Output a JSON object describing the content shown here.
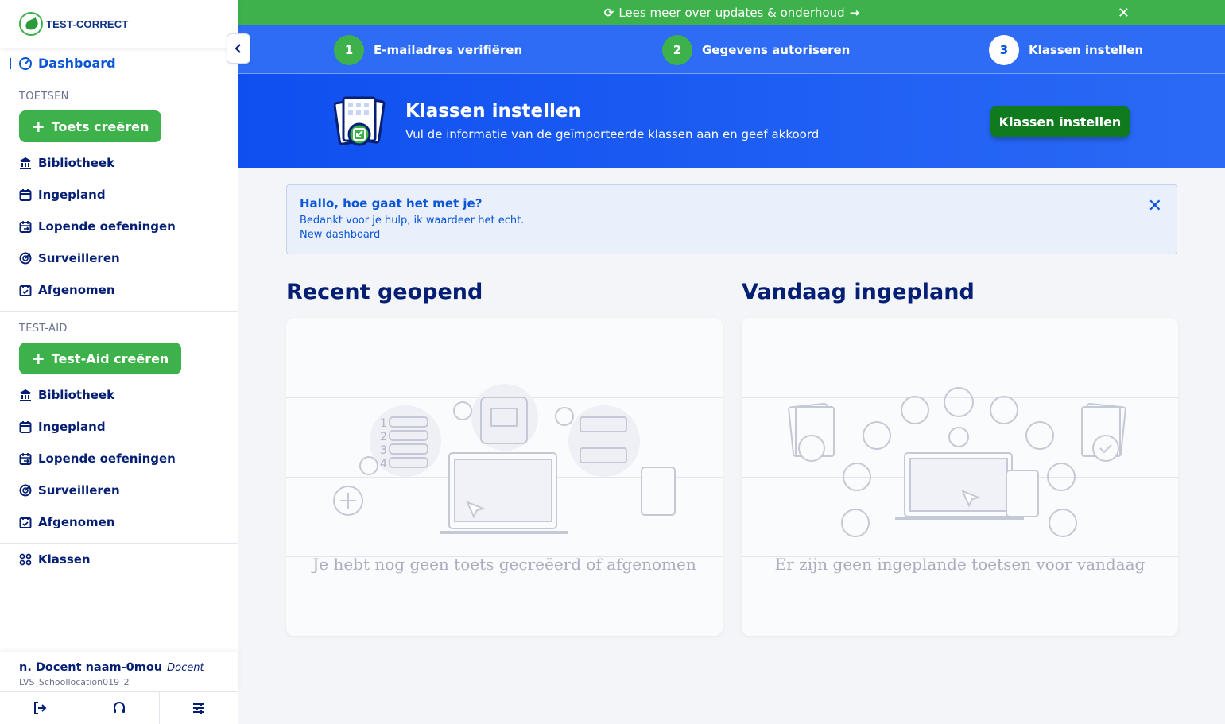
{
  "sidebar": {
    "logo_text": "TEST-CORRECT",
    "dashboard": "Dashboard",
    "toetsen": {
      "title": "TOETSEN",
      "create": "Toets creëren",
      "items": [
        "Bibliotheek",
        "Ingepland",
        "Lopende oefeningen",
        "Surveilleren",
        "Afgenomen"
      ]
    },
    "testaid": {
      "title": "TEST-AID",
      "create": "Test-Aid creëren",
      "items": [
        "Bibliotheek",
        "Ingepland",
        "Lopende oefeningen",
        "Surveilleren",
        "Afgenomen"
      ]
    },
    "klassen": "Klassen",
    "user": {
      "name": "n. Docent naam-0mou",
      "role": "Docent",
      "school": "LVS_Schoollocation019_2"
    }
  },
  "banner": {
    "text": "Lees meer over updates & onderhoud"
  },
  "steps": [
    {
      "num": "1",
      "label": "E-mailadres verifiëren"
    },
    {
      "num": "2",
      "label": "Gegevens autoriseren"
    },
    {
      "num": "3",
      "label": "Klassen instellen"
    }
  ],
  "hero": {
    "title": "Klassen instellen",
    "subtitle": "Vul de informatie van de geïmporteerde klassen aan en geef akkoord",
    "button": "Klassen instellen"
  },
  "message": {
    "title": "Hallo, hoe gaat het met je?",
    "line1": "Bedankt voor je hulp, ik waardeer het echt.",
    "line2": "New dashboard"
  },
  "recent": {
    "title": "Recent geopend",
    "empty": "Je hebt nog geen toets gecreëerd of afgenomen"
  },
  "today": {
    "title": "Vandaag ingepland",
    "empty": "Er zijn geen ingeplande toetsen voor vandaag"
  },
  "colors": {
    "green": "#3db14a",
    "blue": "#2e6cf5",
    "navy": "#041f74",
    "link_blue": "#0a55d8"
  }
}
